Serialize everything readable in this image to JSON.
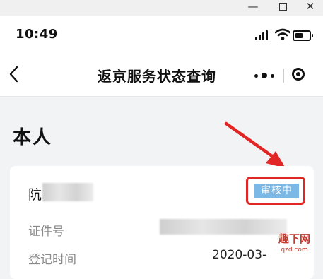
{
  "window": {
    "minimize": "—",
    "close": "✕"
  },
  "status_bar": {
    "time": "10:49"
  },
  "nav": {
    "title": "返京服务状态查询"
  },
  "section": {
    "title": "本人"
  },
  "card": {
    "name_visible": "阬",
    "status": "审核中",
    "id_label": "证件号",
    "reg_label": "登记时间",
    "reg_date": "2020-03-",
    "status_color": "#7bb8e6",
    "highlight_color": "#e12626"
  },
  "watermark": {
    "text": "趣下网",
    "sub": "qzd.com"
  }
}
